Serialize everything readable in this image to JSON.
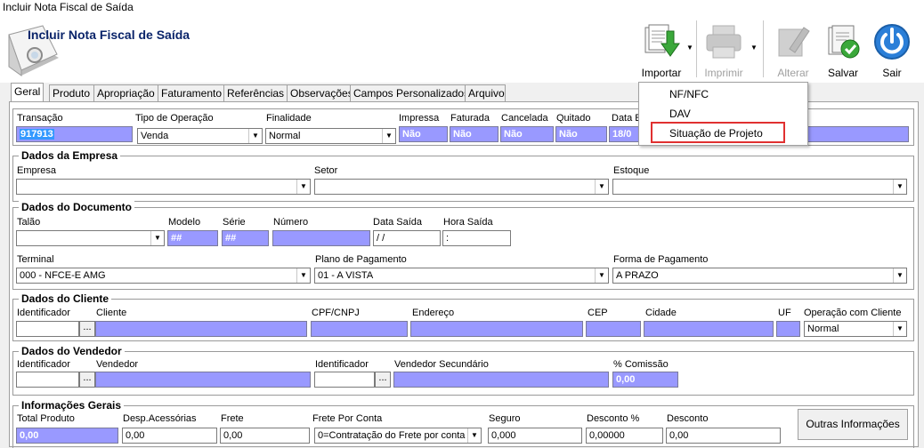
{
  "window": {
    "title": "Incluir Nota Fiscal de Saída"
  },
  "header": {
    "title": "Incluir Nota Fiscal de Saída"
  },
  "toolbar": {
    "importar": "Importar",
    "imprimir": "Imprimir",
    "alterar": "Alterar",
    "salvar": "Salvar",
    "sair": "Sair"
  },
  "tabs": [
    "Geral",
    "Produto",
    "Apropriação",
    "Faturamento",
    "Referências",
    "Observações",
    "Campos Personalizados",
    "Arquivo"
  ],
  "import_menu": {
    "items": [
      "NF/NFC",
      "DAV",
      "Situação de Projeto"
    ]
  },
  "top_row": {
    "labels": {
      "transacao": "Transação",
      "tipo_operacao": "Tipo de Operação",
      "finalidade": "Finalidade",
      "impressa": "Impressa",
      "faturada": "Faturada",
      "cancelada": "Cancelada",
      "quitado": "Quitado",
      "data_e": "Data E"
    },
    "values": {
      "transacao": "917913",
      "tipo_operacao": "Venda",
      "finalidade": "Normal",
      "impressa": "Não",
      "faturada": "Não",
      "cancelada": "Não",
      "quitado": "Não",
      "data_e": "18/0"
    }
  },
  "empresa": {
    "title": "Dados da Empresa",
    "labels": {
      "empresa": "Empresa",
      "setor": "Setor",
      "estoque": "Estoque"
    }
  },
  "documento": {
    "title": "Dados do Documento",
    "labels": {
      "talao": "Talão",
      "modelo": "Modelo",
      "serie": "Série",
      "numero": "Número",
      "data_saida": "Data Saída",
      "hora_saida": "Hora Saída",
      "terminal": "Terminal",
      "plano": "Plano de Pagamento",
      "forma": "Forma de Pagamento"
    },
    "values": {
      "modelo": "##",
      "serie": "##",
      "data_saida": " / /",
      "hora_saida": ":",
      "terminal": "000 - NFCE-E AMG",
      "plano": "01 - A VISTA",
      "forma": "A PRAZO"
    }
  },
  "cliente": {
    "title": "Dados do Cliente",
    "labels": {
      "identificador": "Identificador",
      "cliente": "Cliente",
      "cpf": "CPF/CNPJ",
      "endereco": "Endereço",
      "cep": "CEP",
      "cidade": "Cidade",
      "uf": "UF",
      "operacao": "Operação com Cliente"
    },
    "values": {
      "operacao": "Normal"
    }
  },
  "vendedor": {
    "title": "Dados  do Vendedor",
    "labels": {
      "identificador": "Identificador",
      "vendedor": "Vendedor",
      "identificador2": "Identificador",
      "vendedor_sec": "Vendedor Secundário",
      "comissao": "% Comissão"
    },
    "values": {
      "comissao": "0,00"
    }
  },
  "gerais": {
    "title": "Informações Gerais",
    "labels": {
      "total_produto": "Total Produto",
      "desp": "Desp.Acessórias",
      "frete": "Frete",
      "frete_conta": "Frete Por Conta",
      "seguro": "Seguro",
      "desconto_pct": "Desconto %",
      "desconto": "Desconto"
    },
    "values": {
      "total_produto": "0,00",
      "desp": "0,00",
      "frete": "0,00",
      "frete_conta": "0=Contratação do Frete por conta",
      "seguro": "0,000",
      "desconto_pct": "0,00000",
      "desconto": "0,00"
    },
    "outras_button": "Outras Informações"
  },
  "colors": {
    "field_blue": "#9999ff",
    "selection": "#3399ff",
    "title_blue": "#0a246a",
    "highlight_red": "#e03030"
  }
}
